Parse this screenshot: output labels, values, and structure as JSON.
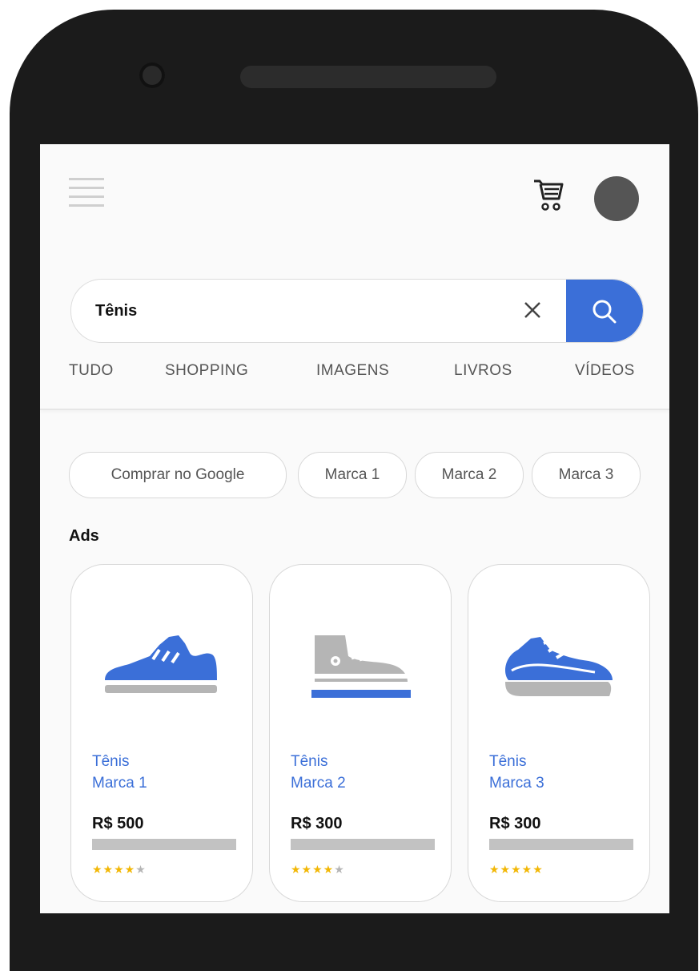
{
  "header": {
    "menu_icon": "hamburger-menu-icon",
    "cart_icon": "shopping-cart-icon",
    "avatar_color": "#555555"
  },
  "search": {
    "value": "Tênis",
    "clear_icon": "close-icon",
    "search_icon": "search-icon",
    "button_color": "#3b6fd8"
  },
  "tabs": [
    "TUDO",
    "SHOPPING",
    "IMAGENS",
    "LIVROS",
    "VÍDEOS"
  ],
  "chips": [
    "Comprar no Google",
    "Marca 1",
    "Marca 2",
    "Marca 3"
  ],
  "ads": {
    "label": "Ads",
    "products": [
      {
        "name_line1": "Tênis",
        "name_line2": "Marca 1",
        "price": "R$ 500",
        "rating": 4,
        "image": "sneaker-icon"
      },
      {
        "name_line1": "Tênis",
        "name_line2": "Marca 2",
        "price": "R$ 300",
        "rating": 4,
        "image": "high-top-sneaker-icon"
      },
      {
        "name_line1": "Tênis",
        "name_line2": "Marca 3",
        "price": "R$ 300",
        "rating": 5,
        "image": "running-shoe-icon"
      }
    ]
  },
  "colors": {
    "accent": "#3b6fd8",
    "star": "#f2b705",
    "shoe_gray": "#b5b5b5"
  }
}
